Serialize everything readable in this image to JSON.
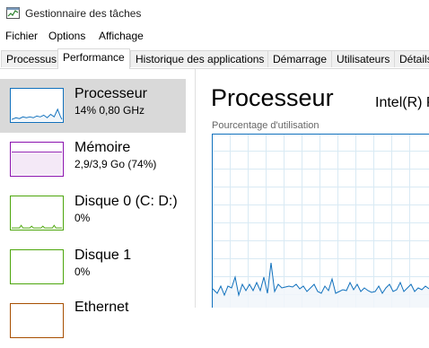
{
  "window": {
    "title": "Gestionnaire des tâches",
    "icon": "task-manager-icon"
  },
  "menu": {
    "items": [
      "Fichier",
      "Options",
      "Affichage"
    ]
  },
  "tabs": [
    {
      "label": "Processus",
      "active": false
    },
    {
      "label": "Performance",
      "active": true
    },
    {
      "label": "Historique des applications",
      "active": false
    },
    {
      "label": "Démarrage",
      "active": false
    },
    {
      "label": "Utilisateurs",
      "active": false
    },
    {
      "label": "Détails",
      "active": false
    }
  ],
  "resources": [
    {
      "name": "Processeur",
      "value": "14% 0,80 GHz",
      "color": "#1171bd",
      "selected": true
    },
    {
      "name": "Mémoire",
      "value": "2,9/3,9 Go (74%)",
      "color": "#8b12ae",
      "selected": false
    },
    {
      "name": "Disque 0 (C: D:)",
      "value": "0%",
      "color": "#4da60c",
      "selected": false
    },
    {
      "name": "Disque 1",
      "value": "0%",
      "color": "#4da60c",
      "selected": false
    },
    {
      "name": "Ethernet",
      "value": "",
      "color": "#a74f01",
      "selected": false
    }
  ],
  "main": {
    "title": "Processeur",
    "model": "Intel(R) P",
    "chart_label": "Pourcentage d'utilisation"
  },
  "colors": {
    "cpu_line": "#1171bd",
    "cpu_fill": "#f1f6fa",
    "grid": "#d9eaf4",
    "selected_bg": "#d9d9d9"
  }
}
